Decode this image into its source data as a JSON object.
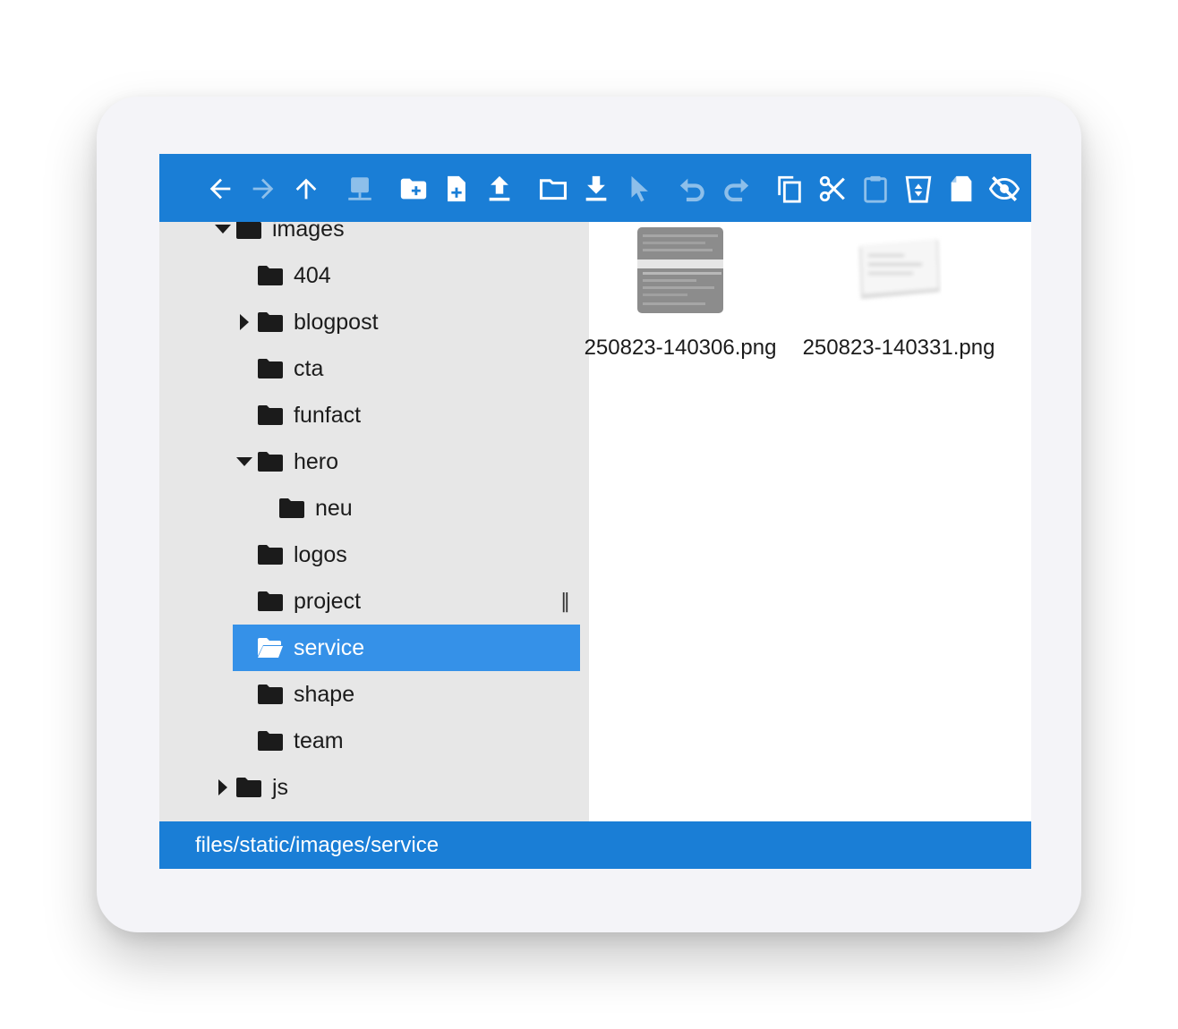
{
  "toolbar": {
    "buttons": [
      {
        "icon": "arrow-left-icon",
        "enabled": true
      },
      {
        "icon": "arrow-right-icon",
        "enabled": false
      },
      {
        "icon": "arrow-up-icon",
        "enabled": true
      },
      {
        "icon": "network-icon",
        "enabled": false
      },
      {
        "icon": "new-folder-icon",
        "enabled": true
      },
      {
        "icon": "new-file-icon",
        "enabled": true
      },
      {
        "icon": "upload-icon",
        "enabled": true
      },
      {
        "icon": "open-folder-icon",
        "enabled": true
      },
      {
        "icon": "download-icon",
        "enabled": true
      },
      {
        "icon": "select-cursor-icon",
        "enabled": false
      },
      {
        "icon": "undo-icon",
        "enabled": false
      },
      {
        "icon": "redo-icon",
        "enabled": false
      },
      {
        "icon": "copy-icon",
        "enabled": true
      },
      {
        "icon": "cut-icon",
        "enabled": true
      },
      {
        "icon": "paste-icon",
        "enabled": false
      },
      {
        "icon": "recycle-bin-icon",
        "enabled": true
      },
      {
        "icon": "erase-icon",
        "enabled": true
      },
      {
        "icon": "hidden-eye-icon",
        "enabled": true
      }
    ]
  },
  "tree": {
    "nodes": [
      {
        "label": "images",
        "caret": "expanded"
      },
      {
        "label": "404",
        "caret": "none"
      },
      {
        "label": "blogpost",
        "caret": "collapsed"
      },
      {
        "label": "cta",
        "caret": "none"
      },
      {
        "label": "funfact",
        "caret": "none"
      },
      {
        "label": "hero",
        "caret": "expanded"
      },
      {
        "label": "neu",
        "caret": "none"
      },
      {
        "label": "logos",
        "caret": "none"
      },
      {
        "label": "project",
        "caret": "none"
      },
      {
        "label": "service",
        "caret": "none",
        "selected": true
      },
      {
        "label": "shape",
        "caret": "none"
      },
      {
        "label": "team",
        "caret": "none"
      },
      {
        "label": "js",
        "caret": "collapsed"
      }
    ],
    "splitter_glyph": "‖"
  },
  "files": [
    {
      "name": "250823-140306.png",
      "icon": "image-thumbnail-icon"
    },
    {
      "name": "250823-140331.png",
      "icon": "image-thumbnail-icon"
    }
  ],
  "status": {
    "path": "files/static/images/service"
  },
  "colors": {
    "accent": "#1a7ed6",
    "selection": "#3591e8",
    "tree_bg": "#e7e7e7"
  }
}
